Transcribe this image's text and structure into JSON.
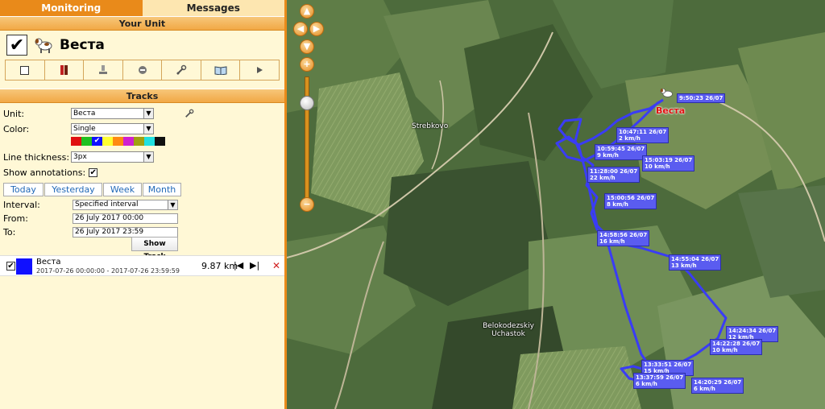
{
  "tabs": [
    "Monitoring",
    "Messages"
  ],
  "your_unit": {
    "header": "Your Unit",
    "name": "Веста",
    "toolbar_icons": [
      "square-icon",
      "battery-icon",
      "pin-icon",
      "minus-circle-icon",
      "wrench-icon",
      "book-icon",
      "play-icon"
    ]
  },
  "tracks": {
    "header": "Tracks",
    "unit_label": "Unit:",
    "unit_value": "Веста",
    "color_label": "Color:",
    "color_value": "Single",
    "swatches": [
      "#e01010",
      "#20c020",
      "#1010ff",
      "#ffff30",
      "#ff8a10",
      "#d020d0",
      "#a0a010",
      "#20e0e0",
      "#101010"
    ],
    "thickness_label": "Line thickness:",
    "thickness_value": "3px",
    "annotations_label": "Show annotations:",
    "periods": [
      "Today",
      "Yesterday",
      "Week",
      "Month"
    ],
    "interval_label": "Interval:",
    "interval_value": "Specified interval",
    "from_label": "From:",
    "from_value": "26 July 2017 00:00",
    "to_label": "To:",
    "to_value": "26 July 2017 23:59",
    "show_button": "Show Track"
  },
  "track_item": {
    "name": "Веста",
    "range": "2017-07-26 00:00:00 - 2017-07-26 23:59:59",
    "distance": "9.87 km",
    "color": "#1010ff"
  },
  "map": {
    "places": [
      "Strebkovo",
      "Belokodezskiy Uchastok"
    ],
    "unit_label": "Веста",
    "annotations": [
      {
        "time": "9:50:23 26/07",
        "speed": ""
      },
      {
        "time": "10:47:11 26/07",
        "speed": "2 km/h"
      },
      {
        "time": "10:59:45 26/07",
        "speed": "9 km/h"
      },
      {
        "time": "15:03:19 26/07",
        "speed": "10 km/h"
      },
      {
        "time": "11:28:00 26/07",
        "speed": "22 km/h"
      },
      {
        "time": "15:00:56 26/07",
        "speed": "8 km/h"
      },
      {
        "time": "14:58:56 26/07",
        "speed": "16 km/h"
      },
      {
        "time": "14:55:04 26/07",
        "speed": "13 km/h"
      },
      {
        "time": "14:24:34 26/07",
        "speed": "12 km/h"
      },
      {
        "time": "14:22:28 26/07",
        "speed": "10 km/h"
      },
      {
        "time": "13:33:51 26/07",
        "speed": "15 km/h"
      },
      {
        "time": "13:37:59 26/07",
        "speed": "6 km/h"
      },
      {
        "time": "14:20:29 26/07",
        "speed": "6 km/h"
      }
    ]
  }
}
